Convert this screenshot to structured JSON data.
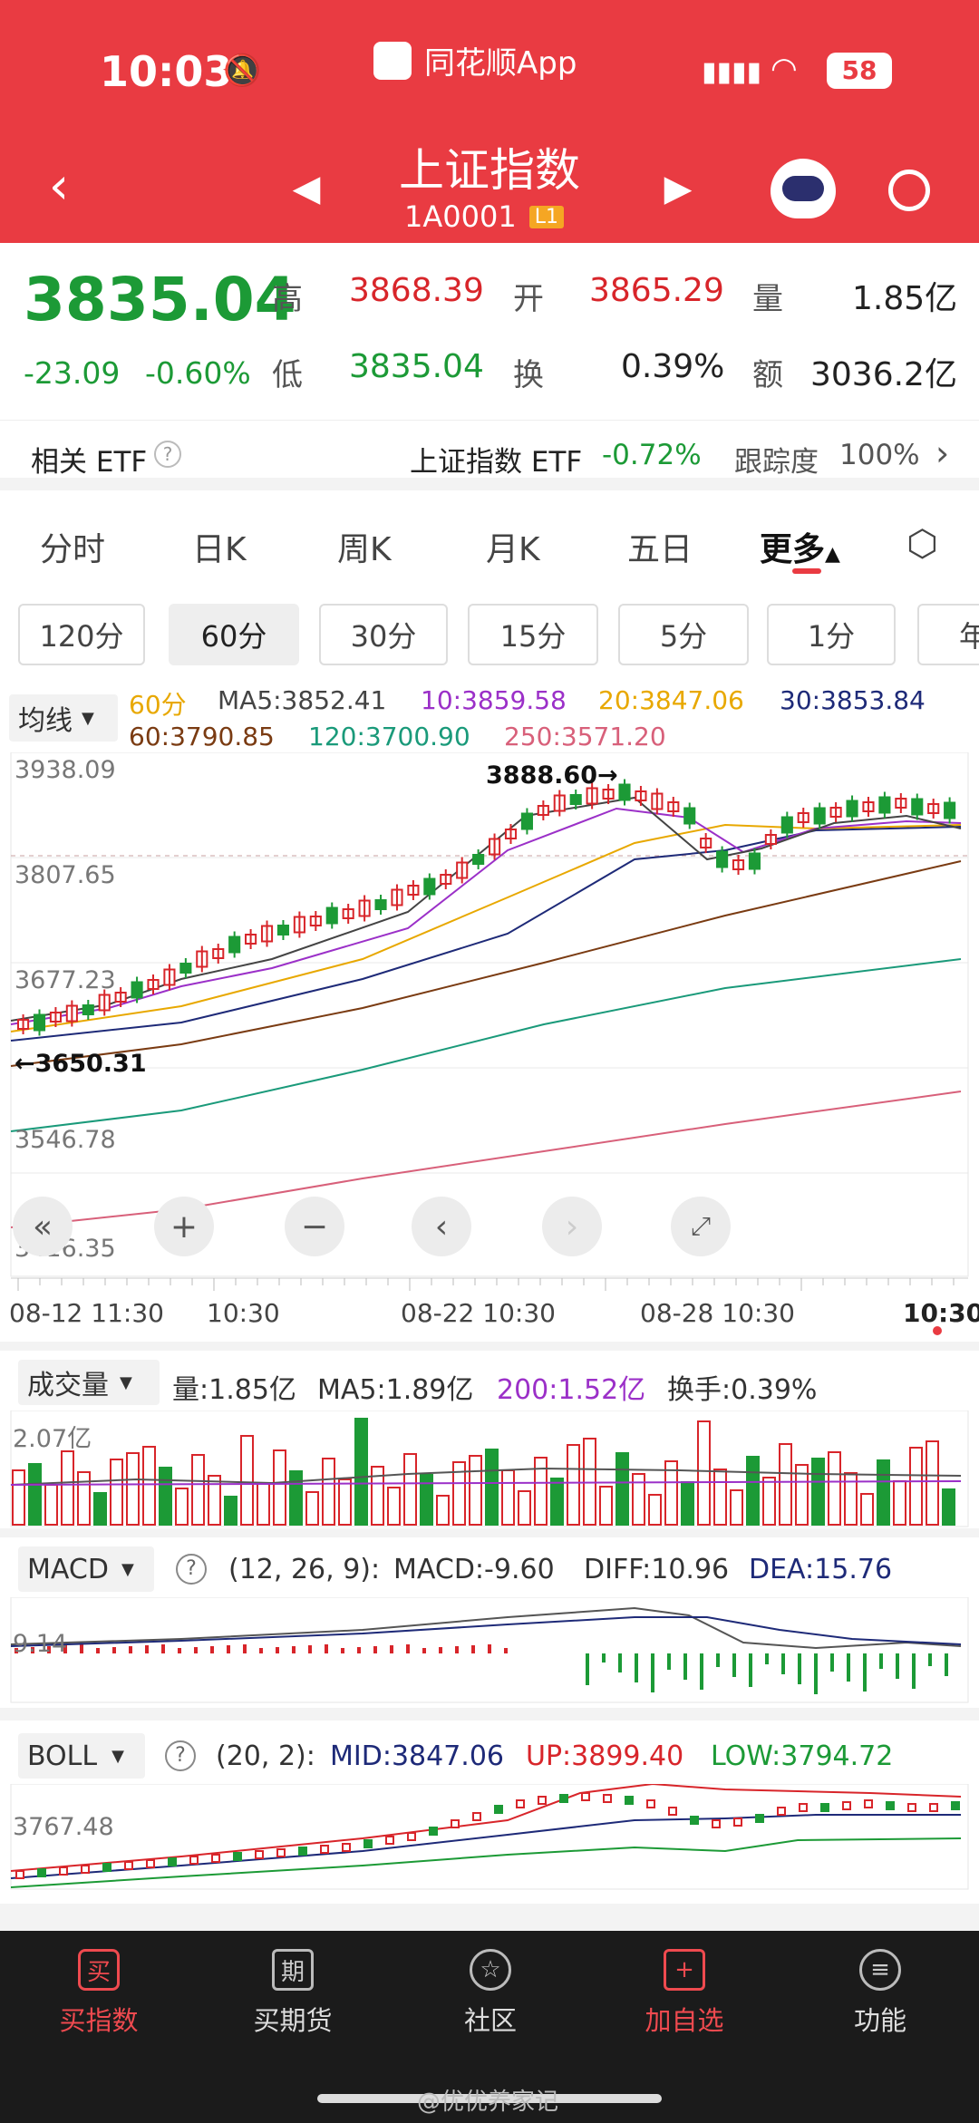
{
  "status": {
    "time": "10:03",
    "app": "同花顺App",
    "battery": "58"
  },
  "header": {
    "title": "上证指数",
    "code": "1A0001",
    "level": "L1"
  },
  "quote": {
    "price": "3835.04",
    "change": "-23.09",
    "change_pct": "-0.60%",
    "high_label": "高",
    "high": "3868.39",
    "open_label": "开",
    "open": "3865.29",
    "vol_label": "量",
    "vol": "1.85亿",
    "low_label": "低",
    "low": "3835.04",
    "turn_label": "换",
    "turn": "0.39%",
    "amt_label": "额",
    "amt": "3036.2亿"
  },
  "etf": {
    "label": "相关 ETF",
    "name": "上证指数 ETF",
    "pct": "-0.72%",
    "track_label": "跟踪度",
    "track": "100%"
  },
  "tabs": [
    "分时",
    "日K",
    "周K",
    "月K",
    "五日",
    "更多"
  ],
  "periods": [
    "120分",
    "60分",
    "30分",
    "15分",
    "5分",
    "1分",
    "年"
  ],
  "ma": {
    "selector": "均线",
    "period": "60分",
    "ma5": "MA5:3852.41",
    "ma10": "10:3859.58",
    "ma20": "20:3847.06",
    "ma30": "30:3853.84",
    "ma60": "60:3790.85",
    "ma120": "120:3700.90",
    "ma250": "250:3571.20"
  },
  "kchart": {
    "y1": "3938.09",
    "y2": "3807.65",
    "y3": "3677.23",
    "y4": "3546.78",
    "y5": "3416.35",
    "max_note": "3888.60→",
    "min_note": "←3650.31"
  },
  "xaxis": [
    "08-12 11:30",
    "10:30",
    "08-22 10:30",
    "08-28 10:30",
    "10:30"
  ],
  "volume": {
    "selector": "成交量",
    "vol": "量:1.85亿",
    "ma5": "MA5:1.89亿",
    "ma200": "200:1.52亿",
    "turn": "换手:0.39%",
    "yref": "2.07亿"
  },
  "macd": {
    "selector": "MACD",
    "params": "(12, 26, 9):",
    "macd": "MACD:-9.60",
    "diff": "DIFF:10.96",
    "dea": "DEA:15.76",
    "yref": "9.14"
  },
  "boll": {
    "selector": "BOLL",
    "params": "(20, 2):",
    "mid": "MID:3847.06",
    "up": "UP:3899.40",
    "low": "LOW:3794.72",
    "yref": "3767.48"
  },
  "nav": [
    "买指数",
    "买期货",
    "社区",
    "加自选",
    "功能"
  ],
  "watermark": "@优优养家记",
  "colors": {
    "brand": "#e93b42",
    "up": "#d8252a",
    "down": "#1c9a36",
    "ma5": "#555555",
    "ma10": "#9b30c8",
    "ma20": "#e8a800",
    "ma30": "#1e2a78",
    "ma60": "#7a3b12",
    "ma120": "#1a9a7a",
    "ma250": "#d8607a"
  }
}
